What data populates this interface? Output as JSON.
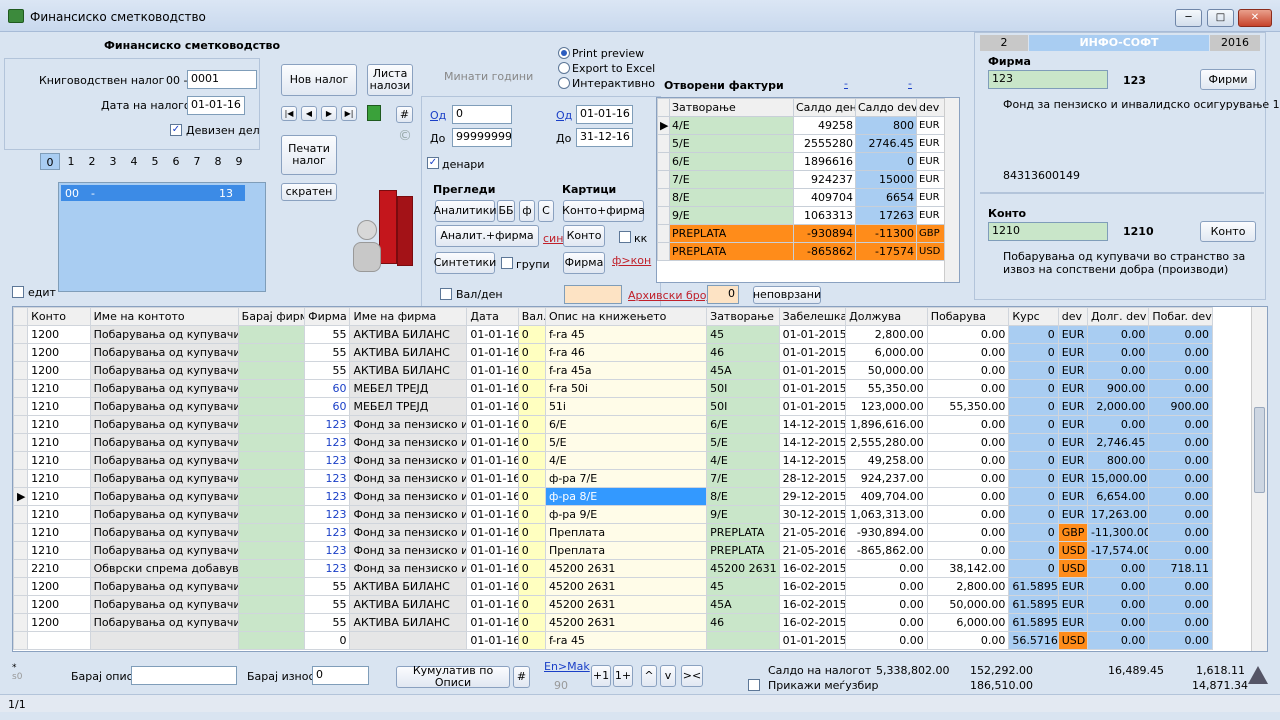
{
  "window": {
    "title": "Финансиско сметководство",
    "min": "─",
    "max": "□",
    "close": "✕"
  },
  "header": {
    "title": "Финансиско сметководство"
  },
  "form": {
    "nalog_label": "Книговодствен налог",
    "nalog_prefix": "00 -",
    "nalog_value": "0001",
    "date_label": "Дата на налогот",
    "date_value": "01-01-16",
    "devizen_label": "Девизен дел",
    "tabs": [
      "0",
      "1",
      "2",
      "3",
      "4",
      "5",
      "6",
      "7",
      "8",
      "9"
    ],
    "list_item": {
      "code": "00",
      "sep": "-",
      "count": "13"
    },
    "edit_label": "едит"
  },
  "buttons": {
    "nov_nalog": "Нов налог",
    "lista_nalozi": "Листа налози",
    "pechati_nalog": "Печати налог",
    "skraten": "скратен",
    "hash": "#",
    "copyright": "©",
    "nav_first": "|◀",
    "nav_prev": "◀",
    "nav_next": "▶",
    "nav_last": "▶|"
  },
  "minati": "Минати години",
  "export_options": [
    "Print preview",
    "Export to Excel",
    "Интерактивно"
  ],
  "filter": {
    "od_label": "Од",
    "od_value": "0",
    "do_label": "До",
    "do_value": "99999999",
    "od_date_label": "Од",
    "od_date": "01-01-16",
    "do_date_label": "До",
    "do_date": "31-12-16",
    "denari": "денари",
    "pregledi": "Прегледи",
    "kartici": "Картици",
    "analitiki": "Аналитики",
    "bb": "ББ",
    "f": "ф",
    "s": "С",
    "konto_firma": "Конто+фирма",
    "analit_firma": "Аналит.+фирма",
    "sin": "син",
    "konto": "Конто",
    "kk": "кк",
    "sintetiki": "Синтетики",
    "grupi": "групи",
    "firma": "Фирма",
    "f_kon": "ф>кон",
    "val_den": "Вал/ден",
    "arhivski": "Архивски број",
    "arhivski_value": "0",
    "nepovrzani": "неповрзани"
  },
  "otvoreni": {
    "title": "Отворени фактури",
    "dash1": "-",
    "dash2": "-",
    "headers": [
      "Затворање",
      "Салдо ден",
      "Салдо dev",
      "dev"
    ],
    "rows": [
      {
        "z": "4/E",
        "sd": "49258",
        "sv": "800",
        "dev": "EUR",
        "org": false
      },
      {
        "z": "5/E",
        "sd": "2555280",
        "sv": "2746.45",
        "dev": "EUR",
        "org": false
      },
      {
        "z": "6/E",
        "sd": "1896616",
        "sv": "0",
        "dev": "EUR",
        "org": false
      },
      {
        "z": "7/E",
        "sd": "924237",
        "sv": "15000",
        "dev": "EUR",
        "org": false
      },
      {
        "z": "8/E",
        "sd": "409704",
        "sv": "6654",
        "dev": "EUR",
        "org": false
      },
      {
        "z": "9/E",
        "sd": "1063313",
        "sv": "17263",
        "dev": "EUR",
        "org": false
      },
      {
        "z": "PREPLATA",
        "sd": "-930894",
        "sv": "-11300",
        "dev": "GBP",
        "org": true
      },
      {
        "z": "PREPLATA",
        "sd": "-865862",
        "sv": "-17574",
        "dev": "USD",
        "org": true
      }
    ]
  },
  "info": {
    "num": "2",
    "company": "ИНФО-СОФТ",
    "year": "2016",
    "firma_label": "Фирма",
    "firma_value": "123",
    "firma_code": "123",
    "firmi_btn": "Фирми",
    "firma_name": "Фонд за пензиско и инвалидско осигурување 1",
    "firma_id": "84313600149",
    "konto_label": "Конто",
    "konto_value": "1210",
    "konto_code": "1210",
    "konto_btn": "Конто",
    "konto_desc": "Побарувања од купувачи во странство за извоз на сопствени добра (производи)"
  },
  "grid": {
    "headers": [
      "Конто",
      "Име на контото",
      "Барај фирма",
      "Фирма",
      "Име на фирма",
      "Дата",
      "Вал.",
      "Опис на книжењето",
      "Затворање",
      "Забелешка",
      "Должува",
      "Побарува",
      "Курс",
      "dev",
      "Долг. dev",
      "Побаr. dev"
    ],
    "rows": [
      {
        "k": "1200",
        "ime": "Побарувања од купувачи од",
        "f": "55",
        "fb": false,
        "fn": "АКТИВА БИЛАНС",
        "d": "01-01-16",
        "v": "0",
        "o": "f-ra 45",
        "z": "45",
        "zb": "01-01-2015",
        "dol": "2,800.00",
        "pob": "0.00",
        "kurs": "0",
        "dev": "EUR",
        "dd": "0.00",
        "pd": "0.00"
      },
      {
        "k": "1200",
        "ime": "Побарувања од купувачи од",
        "f": "55",
        "fb": false,
        "fn": "АКТИВА БИЛАНС",
        "d": "01-01-16",
        "v": "0",
        "o": "f-ra 46",
        "z": "46",
        "zb": "01-01-2015",
        "dol": "6,000.00",
        "pob": "0.00",
        "kurs": "0",
        "dev": "EUR",
        "dd": "0.00",
        "pd": "0.00"
      },
      {
        "k": "1200",
        "ime": "Побарувања од купувачи од",
        "f": "55",
        "fb": false,
        "fn": "АКТИВА БИЛАНС",
        "d": "01-01-16",
        "v": "0",
        "o": "f-ra 45a",
        "z": "45A",
        "zb": "01-01-2015",
        "dol": "50,000.00",
        "pob": "0.00",
        "kurs": "0",
        "dev": "EUR",
        "dd": "0.00",
        "pd": "0.00"
      },
      {
        "k": "1210",
        "ime": "Побарувања од купувачи во",
        "f": "60",
        "fb": true,
        "fn": "МЕБЕЛ ТРЕЈД",
        "d": "01-01-16",
        "v": "0",
        "o": "f-ra 50i",
        "z": "50I",
        "zb": "01-01-2015",
        "dol": "55,350.00",
        "pob": "0.00",
        "kurs": "0",
        "dev": "EUR",
        "dd": "900.00",
        "pd": "0.00"
      },
      {
        "k": "1210",
        "ime": "Побарувања од купувачи во",
        "f": "60",
        "fb": true,
        "fn": "МЕБЕЛ ТРЕЈД",
        "d": "01-01-16",
        "v": "0",
        "o": "51i",
        "z": "50I",
        "zb": "01-01-2015",
        "dol": "123,000.00",
        "pob": "55,350.00",
        "kurs": "0",
        "dev": "EUR",
        "dd": "2,000.00",
        "pd": "900.00"
      },
      {
        "k": "1210",
        "ime": "Побарувања од купувачи во",
        "f": "123",
        "fb": true,
        "fn": "Фонд за пензиско и ин",
        "d": "01-01-16",
        "v": "0",
        "o": "6/E",
        "z": "6/E",
        "zb": "14-12-2015",
        "dol": "1,896,616.00",
        "pob": "0.00",
        "kurs": "0",
        "dev": "EUR",
        "dd": "0.00",
        "pd": "0.00"
      },
      {
        "k": "1210",
        "ime": "Побарувања од купувачи во",
        "f": "123",
        "fb": true,
        "fn": "Фонд за пензиско и ин",
        "d": "01-01-16",
        "v": "0",
        "o": "5/E",
        "z": "5/E",
        "zb": "14-12-2015",
        "dol": "2,555,280.00",
        "pob": "0.00",
        "kurs": "0",
        "dev": "EUR",
        "dd": "2,746.45",
        "pd": "0.00"
      },
      {
        "k": "1210",
        "ime": "Побарувања од купувачи во",
        "f": "123",
        "fb": true,
        "fn": "Фонд за пензиско и ин",
        "d": "01-01-16",
        "v": "0",
        "o": "4/E",
        "z": "4/E",
        "zb": "14-12-2015",
        "dol": "49,258.00",
        "pob": "0.00",
        "kurs": "0",
        "dev": "EUR",
        "dd": "800.00",
        "pd": "0.00"
      },
      {
        "k": "1210",
        "ime": "Побарувања од купувачи во",
        "f": "123",
        "fb": true,
        "fn": "Фонд за пензиско и ин",
        "d": "01-01-16",
        "v": "0",
        "o": "ф-ра 7/E",
        "z": "7/E",
        "zb": "28-12-2015",
        "dol": "924,237.00",
        "pob": "0.00",
        "kurs": "0",
        "dev": "EUR",
        "dd": "15,000.00",
        "pd": "0.00"
      },
      {
        "k": "1210",
        "ime": "Побарувања од купувачи во",
        "f": "123",
        "fb": true,
        "fn": "Фонд за пензиско и ин",
        "d": "01-01-16",
        "v": "0",
        "o": "ф-ра 8/E",
        "z": "8/E",
        "zb": "29-12-2015",
        "dol": "409,704.00",
        "pob": "0.00",
        "kurs": "0",
        "dev": "EUR",
        "dd": "6,654.00",
        "pd": "0.00",
        "sel": true
      },
      {
        "k": "1210",
        "ime": "Побарувања од купувачи во",
        "f": "123",
        "fb": true,
        "fn": "Фонд за пензиско и ин",
        "d": "01-01-16",
        "v": "0",
        "o": "ф-ра 9/E",
        "z": "9/E",
        "zb": "30-12-2015",
        "dol": "1,063,313.00",
        "pob": "0.00",
        "kurs": "0",
        "dev": "EUR",
        "dd": "17,263.00",
        "pd": "0.00"
      },
      {
        "k": "1210",
        "ime": "Побарувања од купувачи во",
        "f": "123",
        "fb": true,
        "fn": "Фонд за пензиско и ин",
        "d": "01-01-16",
        "v": "0",
        "o": "Преплата",
        "z": "PREPLATA",
        "zb": "21-05-2016",
        "dol": "-930,894.00",
        "pob": "0.00",
        "kurs": "0",
        "dev": "GBP",
        "dd": "-11,300.00",
        "pd": "0.00",
        "org": true
      },
      {
        "k": "1210",
        "ime": "Побарувања од купувачи во",
        "f": "123",
        "fb": true,
        "fn": "Фонд за пензиско и ин",
        "d": "01-01-16",
        "v": "0",
        "o": "Преплата",
        "z": "PREPLATA",
        "zb": "21-05-2016",
        "dol": "-865,862.00",
        "pob": "0.00",
        "kurs": "0",
        "dev": "USD",
        "dd": "-17,574.00",
        "pd": "0.00",
        "org": true
      },
      {
        "k": "2210",
        "ime": "Обврски спрема добавувачи",
        "f": "123",
        "fb": true,
        "fn": "Фонд за пензиско и ин",
        "d": "01-01-16",
        "v": "0",
        "o": "45200 2631",
        "z": "45200 2631",
        "zb": "16-02-2015",
        "dol": "0.00",
        "pob": "38,142.00",
        "kurs": "0",
        "dev": "USD",
        "dd": "0.00",
        "pd": "718.11",
        "org": true
      },
      {
        "k": "1200",
        "ime": "Побарувања од купувачи од",
        "f": "55",
        "fb": false,
        "fn": "АКТИВА БИЛАНС",
        "d": "01-01-16",
        "v": "0",
        "o": "45200 2631",
        "z": "45",
        "zb": "16-02-2015",
        "dol": "0.00",
        "pob": "2,800.00",
        "kurs": "61.5895",
        "dev": "EUR",
        "dd": "0.00",
        "pd": "0.00"
      },
      {
        "k": "1200",
        "ime": "Побарувања од купувачи од",
        "f": "55",
        "fb": false,
        "fn": "АКТИВА БИЛАНС",
        "d": "01-01-16",
        "v": "0",
        "o": "45200 2631",
        "z": "45A",
        "zb": "16-02-2015",
        "dol": "0.00",
        "pob": "50,000.00",
        "kurs": "61.5895",
        "dev": "EUR",
        "dd": "0.00",
        "pd": "0.00"
      },
      {
        "k": "1200",
        "ime": "Побарувања од купувачи од",
        "f": "55",
        "fb": false,
        "fn": "АКТИВА БИЛАНС",
        "d": "01-01-16",
        "v": "0",
        "o": "45200 2631",
        "z": "46",
        "zb": "16-02-2015",
        "dol": "0.00",
        "pob": "6,000.00",
        "kurs": "61.5895",
        "dev": "EUR",
        "dd": "0.00",
        "pd": "0.00"
      },
      {
        "k": "",
        "ime": "",
        "f": "0",
        "fb": false,
        "fn": "",
        "d": "01-01-16",
        "v": "0",
        "o": "f-ra 45",
        "z": "",
        "zb": "01-01-2015",
        "dol": "0.00",
        "pob": "0.00",
        "kurs": "56.5716",
        "dev": "USD",
        "dd": "0.00",
        "pd": "0.00",
        "org": true
      }
    ]
  },
  "bottom": {
    "star": "*",
    "s0": "s0",
    "baraj_opis": "Барај опис",
    "baraj_iznos": "Барај износ",
    "iznos_value": "0",
    "kumulativ": "Кумулатив по Описи",
    "hash": "#",
    "en_mak": "En>Mak",
    "ninety": "90",
    "p1": "+1",
    "p1p": "1+",
    "up": "^",
    "down": "v",
    "arrows": "><",
    "saldo_label": "Салдо на налогот",
    "saldo1": "5,338,802.00",
    "saldo2": "152,292.00",
    "saldo3": "16,489.45",
    "saldo4": "1,618.11",
    "prikazi": "Прикажи меѓузбир",
    "saldo5": "186,510.00",
    "saldo6": "14,871.34",
    "status": "1/1"
  }
}
